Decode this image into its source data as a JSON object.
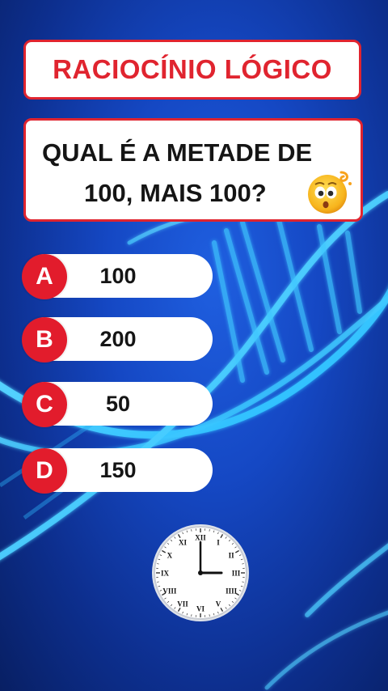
{
  "title": "RACIOCÍNIO LÓGICO",
  "question": {
    "line1": "QUAL É A METADE DE",
    "line2": "100, MAIS 100?"
  },
  "options": [
    {
      "letter": "A",
      "value": "100"
    },
    {
      "letter": "B",
      "value": "200"
    },
    {
      "letter": "C",
      "value": "50"
    },
    {
      "letter": "D",
      "value": "150"
    }
  ],
  "clock": {
    "numerals": [
      "XII",
      "I",
      "II",
      "III",
      "IIII",
      "V",
      "VI",
      "VII",
      "VIII",
      "IX",
      "X",
      "XI"
    ],
    "hour": 3,
    "minute": 0
  },
  "icons": {
    "emoji": "confused-face-icon",
    "clock": "clock-icon"
  },
  "colors": {
    "accent": "#e0242f",
    "background": "#1548c4",
    "dna": "#2ec8ff"
  }
}
